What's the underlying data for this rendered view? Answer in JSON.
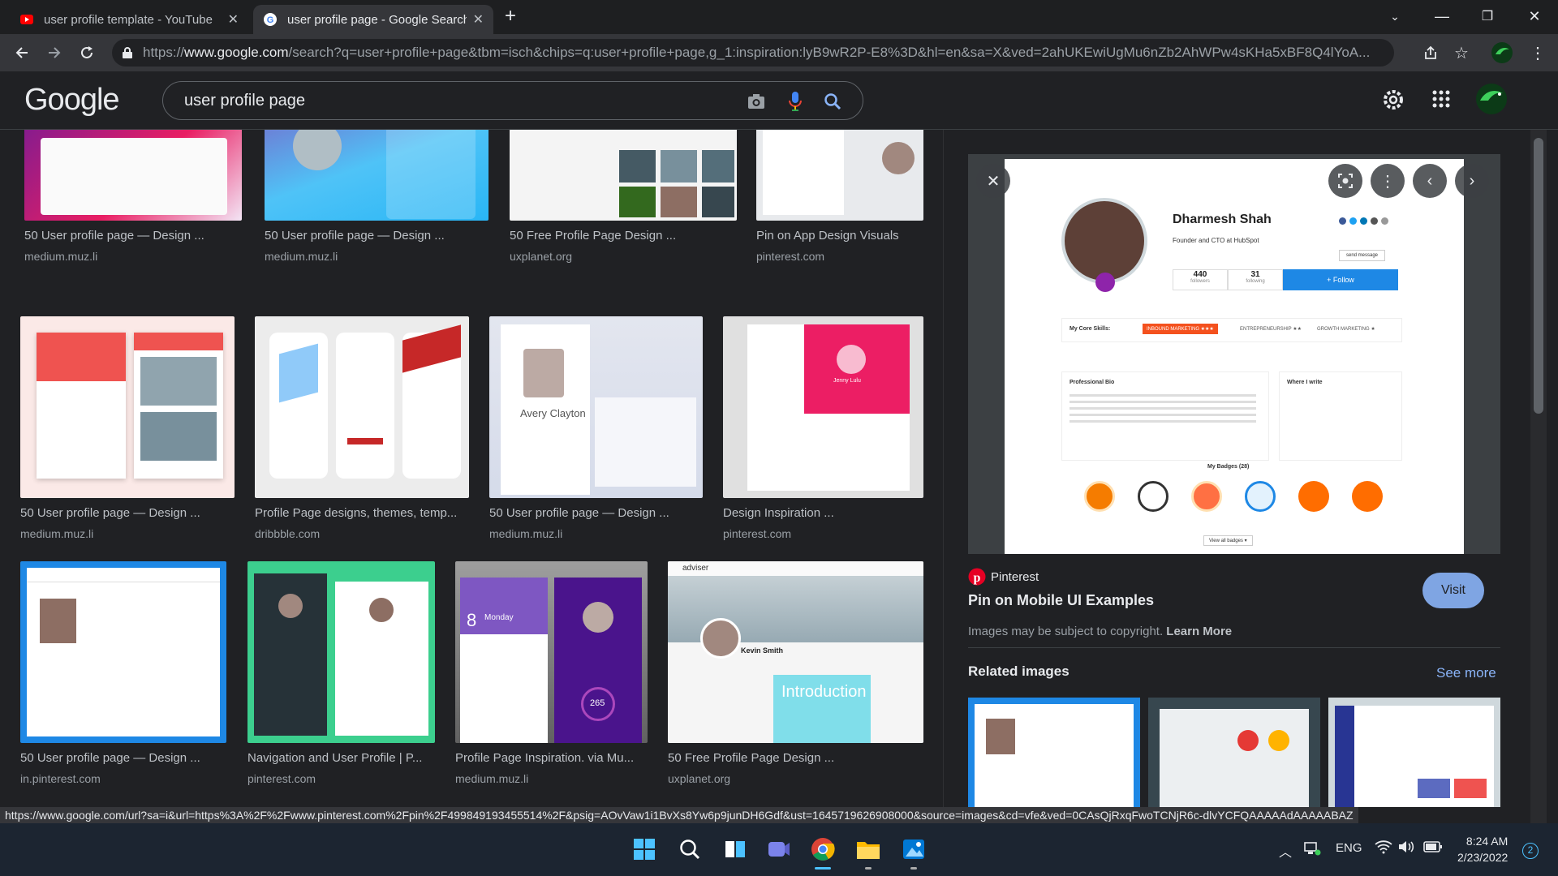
{
  "tabs": [
    {
      "title": "user profile template - YouTube",
      "close": "✕"
    },
    {
      "title": "user profile page - Google Search",
      "close": "✕"
    }
  ],
  "new_tab": "+",
  "url": {
    "prefix": "https://",
    "domain": "www.google.com",
    "rest": "/search?q=user+profile+page&tbm=isch&chips=q:user+profile+page,g_1:inspiration:lyB9wR2P-E8%3D&hl=en&sa=X&ved=2ahUKEwiUgMu6nZb2AhWPw4sKHa5xBF8Q4lYoA..."
  },
  "search": {
    "logo": "Google",
    "query": "user profile page"
  },
  "results": [
    {
      "caption": "50 User profile page — Design ...",
      "source": "medium.muz.li"
    },
    {
      "caption": "50 User profile page — Design ...",
      "source": "medium.muz.li"
    },
    {
      "caption": "50 Free Profile Page Design ...",
      "source": "uxplanet.org"
    },
    {
      "caption": "Pin on App Design Visuals",
      "source": "pinterest.com"
    },
    {
      "caption": "50 User profile page — Design ...",
      "source": "medium.muz.li"
    },
    {
      "caption": "Profile Page designs, themes, temp...",
      "source": "dribbble.com"
    },
    {
      "caption": "50 User profile page — Design ...",
      "source": "medium.muz.li"
    },
    {
      "caption": "Design Inspiration ...",
      "source": "pinterest.com"
    },
    {
      "caption": "50 User profile page — Design ...",
      "source": "in.pinterest.com"
    },
    {
      "caption": "Navigation and User Profile | P...",
      "source": "pinterest.com"
    },
    {
      "caption": "Profile Page Inspiration. via Mu...",
      "source": "medium.muz.li"
    },
    {
      "caption": "50 Free Profile Page Design ...",
      "source": "uxplanet.org"
    }
  ],
  "thumb_text": {
    "avery": "Avery Clayton",
    "kevin": "Kevin Smith",
    "monday_num": "8",
    "monday": "Monday",
    "adviser": "adviser",
    "intro": "Introduction",
    "jenny": "Jenny Lulu",
    "num265": "265"
  },
  "preview": {
    "name": "Dharmesh Shah",
    "role": "Founder and CTO at HubSpot",
    "followers": "440",
    "followers_label": "followers",
    "following": "31",
    "following_label": "following",
    "follow": "+ Follow",
    "send": "send message",
    "core_skills": "My Core Skills:",
    "skill1": "INBOUND MARKETING ★★★",
    "skill2": "ENTREPRENEURSHIP ★★",
    "skill3": "GROWTH MARKETING ★",
    "bio_title": "Professional Bio",
    "where_title": "Where I write",
    "badges_title": "My Badges (28)",
    "view_all": "View all badges ▾"
  },
  "panel": {
    "site": "Pinterest",
    "title": "Pin on Mobile UI Examples",
    "visit": "Visit",
    "copyright": "Images may be subject to copyright.",
    "learn_more": "Learn More",
    "related": "Related images",
    "see_more": "See more"
  },
  "status_url": "https://www.google.com/url?sa=i&url=https%3A%2F%2Fwww.pinterest.com%2Fpin%2F499849193455514%2F&psig=AOvVaw1i1BvXs8Yw6p9junDH6Gdf&ust=1645719626908000&source=images&cd=vfe&ved=0CAsQjRxqFwoTCNjR6c-dlvYCFQAAAAAdAAAAABAZ",
  "taskbar": {
    "lang": "ENG",
    "time": "8:24 AM",
    "date": "2/23/2022",
    "notif": "2"
  }
}
